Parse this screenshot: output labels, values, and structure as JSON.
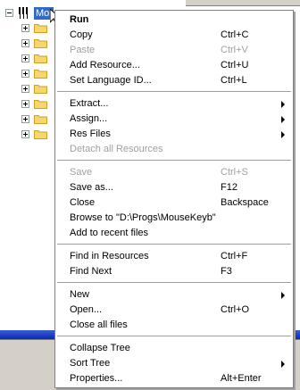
{
  "tree": {
    "root_label": "Mo",
    "child_count": 8
  },
  "menu": {
    "items": [
      {
        "label": "Run",
        "shortcut": "",
        "disabled": false,
        "bold": true,
        "submenu": false
      },
      {
        "label": "Copy",
        "shortcut": "Ctrl+C",
        "disabled": false,
        "bold": false,
        "submenu": false
      },
      {
        "label": "Paste",
        "shortcut": "Ctrl+V",
        "disabled": true,
        "bold": false,
        "submenu": false
      },
      {
        "label": "Add Resource...",
        "shortcut": "Ctrl+U",
        "disabled": false,
        "bold": false,
        "submenu": false
      },
      {
        "label": "Set Language ID...",
        "shortcut": "Ctrl+L",
        "disabled": false,
        "bold": false,
        "submenu": false
      },
      {
        "label": "Extract...",
        "shortcut": "",
        "disabled": false,
        "bold": false,
        "submenu": true
      },
      {
        "label": "Assign...",
        "shortcut": "",
        "disabled": false,
        "bold": false,
        "submenu": true
      },
      {
        "label": "Res Files",
        "shortcut": "",
        "disabled": false,
        "bold": false,
        "submenu": true
      },
      {
        "label": "Detach all Resources",
        "shortcut": "",
        "disabled": true,
        "bold": false,
        "submenu": false
      },
      {
        "label": "Save",
        "shortcut": "Ctrl+S",
        "disabled": true,
        "bold": false,
        "submenu": false
      },
      {
        "label": "Save as...",
        "shortcut": "F12",
        "disabled": false,
        "bold": false,
        "submenu": false
      },
      {
        "label": "Close",
        "shortcut": "Backspace",
        "disabled": false,
        "bold": false,
        "submenu": false
      },
      {
        "label": "Browse to \"D:\\Progs\\MouseKeyb\"",
        "shortcut": "",
        "disabled": false,
        "bold": false,
        "submenu": false
      },
      {
        "label": "Add to recent files",
        "shortcut": "",
        "disabled": false,
        "bold": false,
        "submenu": false
      },
      {
        "label": "Find in Resources",
        "shortcut": "Ctrl+F",
        "disabled": false,
        "bold": false,
        "submenu": false
      },
      {
        "label": "Find Next",
        "shortcut": "F3",
        "disabled": false,
        "bold": false,
        "submenu": false
      },
      {
        "label": "New",
        "shortcut": "",
        "disabled": false,
        "bold": false,
        "submenu": true
      },
      {
        "label": "Open...",
        "shortcut": "Ctrl+O",
        "disabled": false,
        "bold": false,
        "submenu": false
      },
      {
        "label": "Close all files",
        "shortcut": "",
        "disabled": false,
        "bold": false,
        "submenu": false
      },
      {
        "label": "Collapse Tree",
        "shortcut": "",
        "disabled": false,
        "bold": false,
        "submenu": false
      },
      {
        "label": "Sort Tree",
        "shortcut": "",
        "disabled": false,
        "bold": false,
        "submenu": true
      },
      {
        "label": "Properties...",
        "shortcut": "Alt+Enter",
        "disabled": false,
        "bold": false,
        "submenu": false
      }
    ]
  },
  "colors": {
    "selection": "#316ac5",
    "disabled_text": "#a0a0a0",
    "folder": "#f7d66b",
    "taskbar": "#0a2ab0"
  }
}
